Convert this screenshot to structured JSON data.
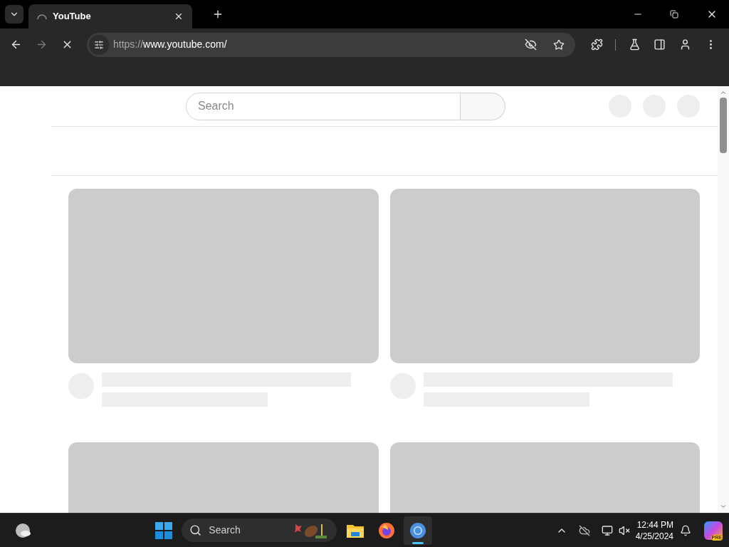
{
  "browser": {
    "tabs": [
      {
        "title": "YouTube",
        "selected": true,
        "loading": true
      }
    ],
    "address": {
      "scheme": "https://",
      "host": "www.youtube.com/"
    }
  },
  "page": {
    "search": {
      "placeholder": "Search"
    },
    "video_placeholders": [
      {
        "kind": "full"
      },
      {
        "kind": "full"
      },
      {
        "kind": "thumb"
      },
      {
        "kind": "thumb"
      }
    ]
  },
  "taskbar": {
    "search": {
      "placeholder": "Search"
    },
    "apps": [
      {
        "kind": "explorer",
        "selected": false
      },
      {
        "kind": "firefox",
        "selected": false
      },
      {
        "kind": "chrome",
        "selected": true
      }
    ],
    "clock": {
      "time": "12:44 PM",
      "date": "4/25/2024"
    },
    "copilot_badge": "PRE"
  }
}
